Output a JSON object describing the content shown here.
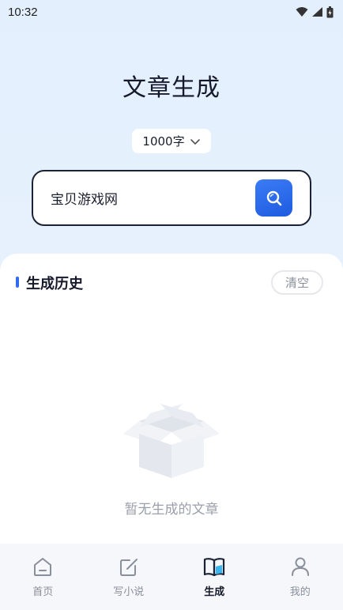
{
  "status_bar": {
    "time": "10:32"
  },
  "page": {
    "title": "文章生成"
  },
  "word_count": {
    "selected": "1000字"
  },
  "search": {
    "value": "宝贝游戏网"
  },
  "history": {
    "title": "生成历史",
    "clear_label": "清空",
    "empty_text": "暂无生成的文章"
  },
  "tabbar": {
    "items": [
      {
        "label": "首页",
        "icon": "home-icon",
        "active": false
      },
      {
        "label": "写小说",
        "icon": "edit-icon",
        "active": false
      },
      {
        "label": "生成",
        "icon": "book-icon",
        "active": true
      },
      {
        "label": "我的",
        "icon": "user-icon",
        "active": false
      }
    ]
  },
  "colors": {
    "accent": "#2f6cf0",
    "background": "#e3effd",
    "text": "#15192a",
    "muted": "#8a8f9c"
  }
}
